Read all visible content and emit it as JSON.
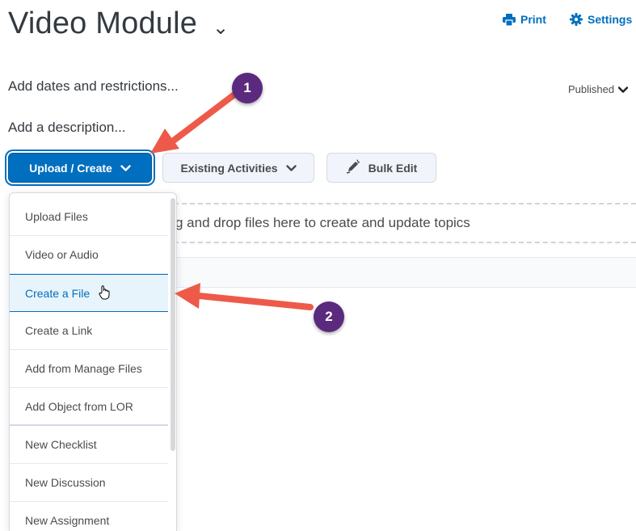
{
  "header": {
    "title": "Video Module",
    "title_chevron": "⌄",
    "print_label": "Print",
    "settings_label": "Settings"
  },
  "module": {
    "add_dates_label": "Add dates and restrictions...",
    "add_description_label": "Add a description...",
    "status_label": "Published"
  },
  "toolbar": {
    "upload_create_label": "Upload / Create",
    "existing_activities_label": "Existing Activities",
    "bulk_edit_label": "Bulk Edit"
  },
  "dropzone": {
    "text": "g and drop files here to create and update topics"
  },
  "menu": {
    "items": [
      {
        "label": "Upload Files"
      },
      {
        "label": "Video or Audio"
      },
      {
        "label": "Create a File"
      },
      {
        "label": "Create a Link"
      },
      {
        "label": "Add from Manage Files"
      },
      {
        "label": "Add Object from LOR"
      },
      {
        "label": "New Checklist"
      },
      {
        "label": "New Discussion"
      },
      {
        "label": "New Assignment"
      }
    ]
  },
  "annotations": {
    "step1": "1",
    "step2": "2",
    "arrow_color": "#ee5a4a",
    "badge_color": "#5b2a7f"
  },
  "colors": {
    "accent": "#006fbf",
    "active_item_bg": "#e8f4fb"
  }
}
